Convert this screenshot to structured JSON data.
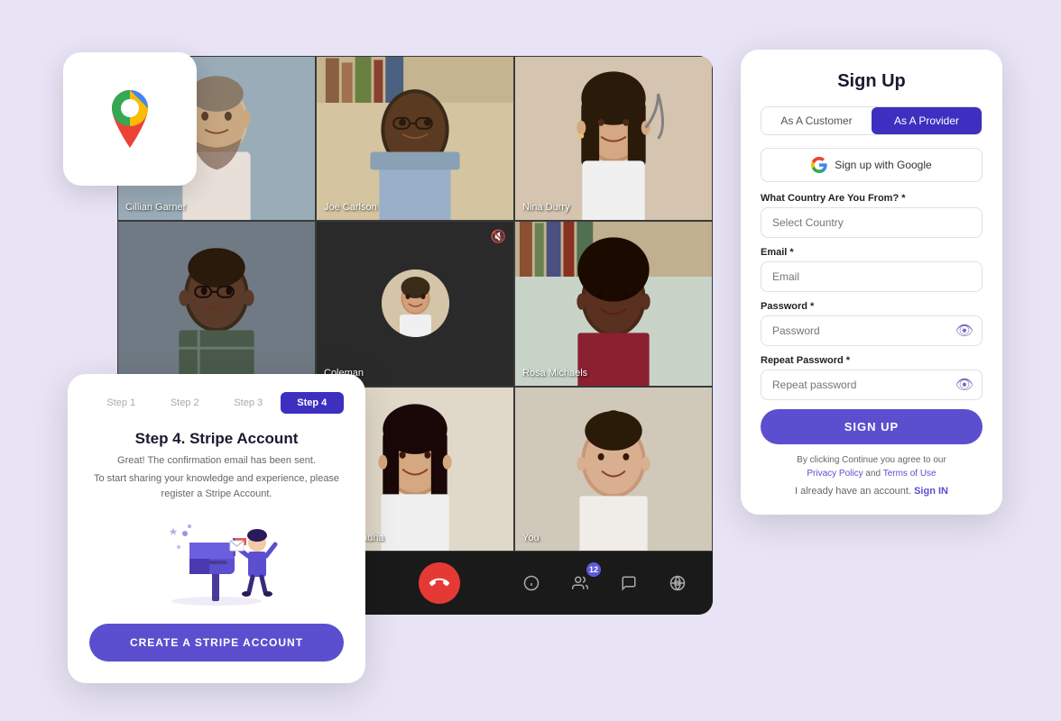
{
  "background_color": "#e8e4f5",
  "maps_card": {
    "alt": "Google Maps Icon"
  },
  "video_call": {
    "participants": [
      {
        "name": "Cillian Garner",
        "position": 1
      },
      {
        "name": "Joe Carlson",
        "position": 2
      },
      {
        "name": "Nina Durry",
        "position": 3
      },
      {
        "name": "",
        "position": 4
      },
      {
        "name": "Coleman",
        "position": 5
      },
      {
        "name": "Rosa Michaels",
        "position": 6
      },
      {
        "name": "",
        "position": 7
      },
      {
        "name": "Priya Chadha",
        "position": 8
      },
      {
        "name": "You",
        "position": 9
      }
    ],
    "controls": {
      "mic": "🎙",
      "camera": "□",
      "share": "⬚",
      "layout": "⊡",
      "more": "⋮",
      "end_call": "📞",
      "info": "ⓘ",
      "participants": "👥",
      "participants_count": "12",
      "chat": "💬",
      "network": "⋮"
    }
  },
  "signup": {
    "title": "Sign Up",
    "tab_customer": "As A Customer",
    "tab_provider": "As A Provider",
    "google_btn": "Sign up with Google",
    "country_label": "What Country Are You From? *",
    "country_placeholder": "Select Country",
    "email_label": "Email *",
    "email_placeholder": "Email",
    "password_label": "Password *",
    "password_placeholder": "Password",
    "repeat_password_label": "Repeat Password *",
    "repeat_password_placeholder": "Repeat password",
    "signup_btn": "SIGN UP",
    "terms_text": "By clicking Continue you agree to our",
    "privacy_policy": "Privacy Policy",
    "and": "and",
    "terms_of_use": "Terms of Use",
    "already_account": "I already have an account.",
    "sign_in": "Sign IN"
  },
  "stripe": {
    "steps": [
      "Step 1",
      "Step 2",
      "Step 3",
      "Step 4"
    ],
    "active_step": 3,
    "title": "Step 4. Stripe Account",
    "subtitle": "Great! The confirmation email has been sent.",
    "description": "To start sharing your knowledge and experience, please register a Stripe Account.",
    "btn_label": "CREATE A STRIPE ACCOUNT"
  }
}
